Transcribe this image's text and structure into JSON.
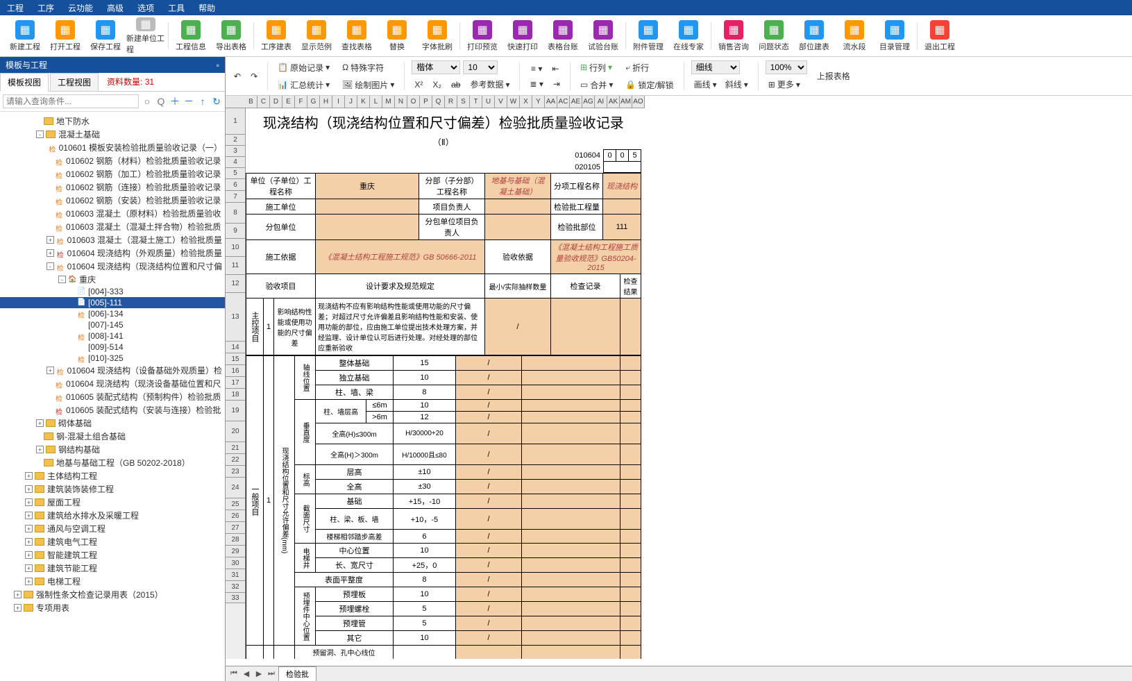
{
  "menu": [
    "工程",
    "工序",
    "云功能",
    "高级",
    "选项",
    "工具",
    "帮助"
  ],
  "toolbar": [
    {
      "label": "新建工程",
      "color": "#2196f3"
    },
    {
      "label": "打开工程",
      "color": "#ff9800"
    },
    {
      "label": "保存工程",
      "color": "#2196f3"
    },
    {
      "label": "新建单位工程",
      "color": "#bbb"
    },
    {
      "label": "工程信息",
      "color": "#4caf50"
    },
    {
      "label": "导出表格",
      "color": "#4caf50"
    },
    {
      "label": "工序建表",
      "color": "#ff9800"
    },
    {
      "label": "显示范例",
      "color": "#ff9800"
    },
    {
      "label": "查找表格",
      "color": "#ff9800"
    },
    {
      "label": "替换",
      "color": "#ff9800"
    },
    {
      "label": "字体批刷",
      "color": "#ff9800"
    },
    {
      "label": "打印预览",
      "color": "#9c27b0"
    },
    {
      "label": "快速打印",
      "color": "#9c27b0"
    },
    {
      "label": "表格台账",
      "color": "#9c27b0"
    },
    {
      "label": "试验台账",
      "color": "#9c27b0"
    },
    {
      "label": "附件管理",
      "color": "#2196f3"
    },
    {
      "label": "在线专家",
      "color": "#2196f3"
    },
    {
      "label": "销售咨询",
      "color": "#e91e63"
    },
    {
      "label": "问题状态",
      "color": "#4caf50"
    },
    {
      "label": "部位建表",
      "color": "#2196f3"
    },
    {
      "label": "流水段",
      "color": "#ff9800"
    },
    {
      "label": "目录管理",
      "color": "#2196f3"
    },
    {
      "label": "退出工程",
      "color": "#f44336"
    }
  ],
  "panel": {
    "title": "模板与工程",
    "tab1": "模板视图",
    "tab2": "工程视图",
    "count_label": "资料数量: ",
    "count": "31",
    "search_ph": "请输入查询条件..."
  },
  "tree": [
    {
      "d": 3,
      "exp": "",
      "ic": "folder",
      "t": "地下防水"
    },
    {
      "d": 3,
      "exp": "-",
      "ic": "folder",
      "t": "混凝土基础"
    },
    {
      "d": 4,
      "exp": "",
      "ic": "检o",
      "t": "010601 模板安装检验批质量验收记录（一）"
    },
    {
      "d": 4,
      "exp": "",
      "ic": "检o",
      "t": "010602 钢筋（材料）检验批质量验收记录"
    },
    {
      "d": 4,
      "exp": "",
      "ic": "检o",
      "t": "010602 钢筋（加工）检验批质量验收记录"
    },
    {
      "d": 4,
      "exp": "",
      "ic": "检o",
      "t": "010602 钢筋（连接）检验批质量验收记录"
    },
    {
      "d": 4,
      "exp": "",
      "ic": "检o",
      "t": "010602 钢筋（安装）检验批质量验收记录"
    },
    {
      "d": 4,
      "exp": "",
      "ic": "检o",
      "t": "010603 混凝土（原材料）检验批质量验收"
    },
    {
      "d": 4,
      "exp": "",
      "ic": "检o",
      "t": "010603 混凝土（混凝土拌合物）检验批质"
    },
    {
      "d": 4,
      "exp": "+",
      "ic": "检o",
      "t": "010603 混凝土（混凝土施工）检验批质量"
    },
    {
      "d": 4,
      "exp": "+",
      "ic": "检r",
      "t": "010604 现浇结构（外观质量）检验批质量"
    },
    {
      "d": 4,
      "exp": "-",
      "ic": "检o",
      "t": "010604 现浇结构（现浇结构位置和尺寸偏"
    },
    {
      "d": 5,
      "exp": "-",
      "ic": "house",
      "t": "重庆"
    },
    {
      "d": 6,
      "exp": "",
      "ic": "doc",
      "t": "[004]-333"
    },
    {
      "d": 6,
      "exp": "",
      "ic": "doc",
      "t": "[005]-111",
      "sel": true
    },
    {
      "d": 6,
      "exp": "",
      "ic": "检o",
      "t": "[006]-134"
    },
    {
      "d": 6,
      "exp": "",
      "ic": "",
      "t": "[007]-145"
    },
    {
      "d": 6,
      "exp": "",
      "ic": "检o",
      "t": "[008]-141"
    },
    {
      "d": 6,
      "exp": "",
      "ic": "",
      "t": "[009]-514"
    },
    {
      "d": 6,
      "exp": "",
      "ic": "检o",
      "t": "[010]-325"
    },
    {
      "d": 4,
      "exp": "+",
      "ic": "检o",
      "t": "010604 现浇结构（设备基础外观质量）检"
    },
    {
      "d": 4,
      "exp": "",
      "ic": "检o",
      "t": "010604 现浇结构（现浇设备基础位置和尺"
    },
    {
      "d": 4,
      "exp": "",
      "ic": "检o",
      "t": "010605 装配式结构（预制构件）检验批质"
    },
    {
      "d": 4,
      "exp": "",
      "ic": "检r",
      "t": "010605 装配式结构（安装与连接）检验批"
    },
    {
      "d": 3,
      "exp": "+",
      "ic": "folder",
      "t": "砌体基础"
    },
    {
      "d": 3,
      "exp": "",
      "ic": "folder",
      "t": "钢-混凝土组合基础"
    },
    {
      "d": 3,
      "exp": "+",
      "ic": "folder",
      "t": "钢结构基础"
    },
    {
      "d": 3,
      "exp": "",
      "ic": "folder",
      "t": "地基与基础工程（GB 50202-2018）"
    },
    {
      "d": 2,
      "exp": "+",
      "ic": "folder",
      "t": "主体结构工程"
    },
    {
      "d": 2,
      "exp": "+",
      "ic": "folder",
      "t": "建筑装饰装修工程"
    },
    {
      "d": 2,
      "exp": "+",
      "ic": "folder",
      "t": "屋面工程"
    },
    {
      "d": 2,
      "exp": "+",
      "ic": "folder",
      "t": "建筑给水排水及采暖工程"
    },
    {
      "d": 2,
      "exp": "+",
      "ic": "folder",
      "t": "通风与空调工程"
    },
    {
      "d": 2,
      "exp": "+",
      "ic": "folder",
      "t": "建筑电气工程"
    },
    {
      "d": 2,
      "exp": "+",
      "ic": "folder",
      "t": "智能建筑工程"
    },
    {
      "d": 2,
      "exp": "+",
      "ic": "folder",
      "t": "建筑节能工程"
    },
    {
      "d": 2,
      "exp": "+",
      "ic": "folder",
      "t": "电梯工程"
    },
    {
      "d": 1,
      "exp": "+",
      "ic": "folder",
      "t": "强制性条文检查记录用表（2015）"
    },
    {
      "d": 1,
      "exp": "+",
      "ic": "folder",
      "t": "专项用表"
    }
  ],
  "ribbon": {
    "rawrec": "原始记录",
    "spchar": "特殊字符",
    "stats": "汇总统计",
    "drawimg": "绘制图片",
    "refdata": "参考数据",
    "font": "楷体",
    "size": "10",
    "col": "行列",
    "merge": "合并",
    "wrap": "折行",
    "lock": "锁定/解锁",
    "line": "细线",
    "border": "画线",
    "diag": "斜线",
    "zoom": "100%",
    "upload": "上报表格",
    "more": "更多"
  },
  "cols": [
    "B",
    "C",
    "D",
    "E",
    "F",
    "G",
    "H",
    "I",
    "J",
    "K",
    "L",
    "M",
    "N",
    "O",
    "P",
    "Q",
    "R",
    "S",
    "T",
    "U",
    "V",
    "W",
    "X",
    "Y",
    "AA",
    "AC",
    "AE",
    "AG",
    "AI",
    "AK",
    "AM",
    "AO"
  ],
  "form": {
    "title": "现浇结构（现浇结构位置和尺寸偏差）检验批质量验收记录",
    "sub": "（Ⅱ）",
    "code1": "010604",
    "codeA": "0",
    "codeB": "0",
    "codeC": "5",
    "code2": "020105",
    "h1": "单位（子单位）工程名称",
    "v1": "重庆",
    "h2": "分部（子分部）工程名称",
    "v2": "地基与基础（混凝土基础）",
    "h3": "分项工程名称",
    "v3": "现浇结构",
    "h4": "施工单位",
    "h5": "项目负责人",
    "h6": "检验批工程量",
    "h7": "分包单位",
    "h8": "分包单位项目负责人",
    "h9": "检验批部位",
    "v9": "111",
    "h10": "施工依据",
    "v10": "《混凝土结构工程施工规范》GB 50666-2011",
    "h11": "验收依据",
    "v11": "《混凝土结构工程施工质量验收规范》GB50204-2015",
    "ch1": "验收项目",
    "ch2": "设计要求及规范规定",
    "ch3": "最小/实际抽样数量",
    "ch4": "检查记录",
    "ch5": "检查结果",
    "main_item": "主控项目",
    "gen_item": "一般项目",
    "mi_name": "影响结构性能或使用功能的尺寸偏差",
    "mi_spec": "现浇结构不应有影响结构性能或使用功能的尺寸偏差；对超过尺寸允许偏差且影响结构性能和安装、使用功能的部位，应由施工单位提出技术处理方案，并经监理、设计单位认可后进行处理。对经处理的部位应重新验收",
    "gi_name": "现浇结构位置和尺寸允许偏差(mm)",
    "axis": "轴线位置",
    "axis_r": [
      [
        "整体基础",
        "15"
      ],
      [
        "独立基础",
        "10"
      ],
      [
        "柱、墙、梁",
        "8"
      ]
    ],
    "vert": "垂直度",
    "vert_r": [
      [
        "柱、墙层高",
        "≤6m",
        "10"
      ],
      [
        "",
        ">6m",
        "12"
      ],
      [
        "全高(H)≤300m",
        "",
        "H/30000+20"
      ],
      [
        "全高(H)＞300m",
        "",
        "H/10000且≤80"
      ]
    ],
    "elev": "标高",
    "elev_r": [
      [
        "层高",
        "±10"
      ],
      [
        "全高",
        "±30"
      ]
    ],
    "sect": "截面尺寸",
    "sect_r": [
      [
        "基础",
        "+15，-10"
      ],
      [
        "柱、梁、板、墙",
        "+10，-5"
      ],
      [
        "楼梯相邻踏步高差",
        "6"
      ]
    ],
    "elevator": "电梯井",
    "elevator_r": [
      [
        "中心位置",
        "10"
      ],
      [
        "长、宽尺寸",
        "+25，0"
      ]
    ],
    "surface": "表面平整度",
    "surface_v": "8",
    "embed": "预埋件中心位置",
    "embed_r": [
      [
        "预埋板",
        "10"
      ],
      [
        "预埋螺栓",
        "5"
      ],
      [
        "预埋管",
        "5"
      ],
      [
        "其它",
        "10"
      ]
    ],
    "last": "预留洞、孔中心线位"
  },
  "sheettab": "检验批"
}
